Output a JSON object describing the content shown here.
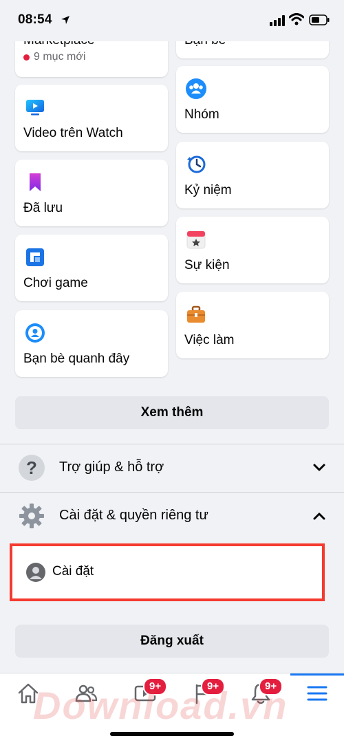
{
  "status_bar": {
    "time": "08:54"
  },
  "shortcuts": {
    "marketplace": {
      "label": "Marketplace",
      "sub": "9 mục mới"
    },
    "friends": {
      "label": "Bạn bè"
    },
    "watch": {
      "label": "Video trên Watch",
      "icon": "video-icon"
    },
    "groups": {
      "label": "Nhóm",
      "icon": "groups-icon"
    },
    "saved": {
      "label": "Đã lưu",
      "icon": "bookmark-icon"
    },
    "memories": {
      "label": "Kỷ niệm",
      "icon": "clock-history-icon"
    },
    "gaming": {
      "label": "Chơi game",
      "icon": "game-icon"
    },
    "events": {
      "label": "Sự kiện",
      "icon": "calendar-icon"
    },
    "nearby": {
      "label": "Bạn bè quanh đây",
      "icon": "location-icon"
    },
    "jobs": {
      "label": "Việc làm",
      "icon": "briefcase-icon"
    }
  },
  "see_more_label": "Xem thêm",
  "sections": {
    "help": {
      "label": "Trợ giúp & hỗ trợ",
      "icon": "question-icon"
    },
    "settings_privacy": {
      "label": "Cài đặt & quyền riêng tư",
      "icon": "gear-icon"
    }
  },
  "settings_item": {
    "label": "Cài đặt"
  },
  "logout_label": "Đăng xuất",
  "bottom_nav": {
    "watch_badge": "9+",
    "pages_badge": "9+",
    "notifications_badge": "9+"
  },
  "watermark": "Download.vn",
  "colors": {
    "accent": "#1877f2",
    "badge": "#e41e3f",
    "highlight": "#f53a30"
  }
}
